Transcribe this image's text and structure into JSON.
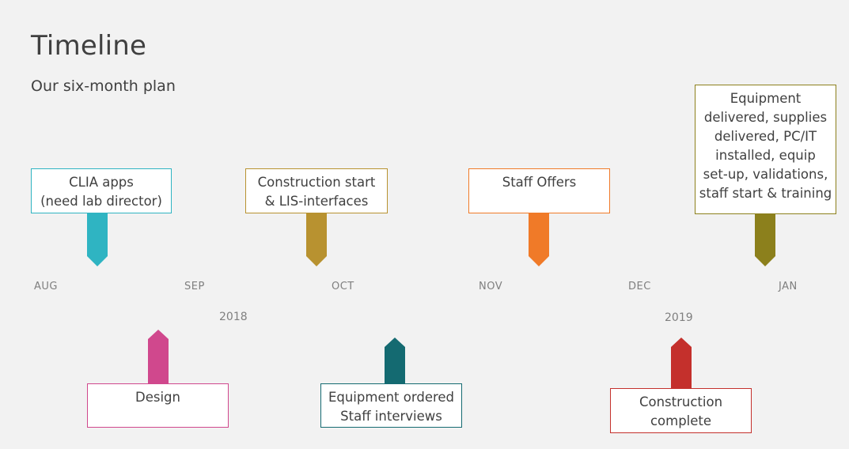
{
  "header": {
    "title": "Timeline",
    "subtitle": "Our six-month plan"
  },
  "axis": {
    "months": [
      "AUG",
      "SEP",
      "OCT",
      "NOV",
      "DEC",
      "JAN"
    ],
    "years": [
      "2018",
      "2019"
    ]
  },
  "milestones": [
    {
      "id": "clia",
      "lines": [
        "CLIA apps",
        "(need lab director)"
      ],
      "color": "#2fb4c2",
      "position": "above"
    },
    {
      "id": "construction-start",
      "lines": [
        "Construction start",
        "& LIS-interfaces"
      ],
      "color": "#b89230",
      "position": "above"
    },
    {
      "id": "staff-offers",
      "lines": [
        "Staff Offers"
      ],
      "color": "#f07a28",
      "position": "above"
    },
    {
      "id": "equipment-delivered",
      "lines": [
        "Equipment",
        "delivered, supplies",
        "delivered, PC/IT",
        "installed, equip",
        "set-up, validations,",
        "staff start & training"
      ],
      "color": "#8c801c",
      "position": "above"
    },
    {
      "id": "design",
      "lines": [
        "Design"
      ],
      "color": "#d0488d",
      "position": "below"
    },
    {
      "id": "equipment-ordered",
      "lines": [
        "Equipment ordered",
        "Staff interviews"
      ],
      "color": "#146a71",
      "position": "below"
    },
    {
      "id": "construction-complete",
      "lines": [
        "Construction",
        "complete"
      ],
      "color": "#c4302c",
      "position": "below"
    }
  ]
}
